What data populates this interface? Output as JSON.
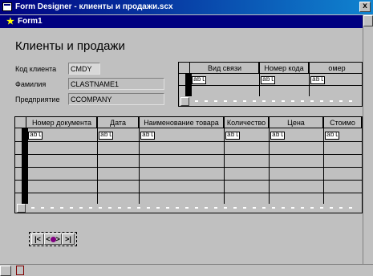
{
  "window": {
    "title": "Form Designer - клиенты и продажи.scx",
    "close_glyph": "x"
  },
  "form_tab": {
    "label": "Form1"
  },
  "form": {
    "heading": "Клиенты и продажи",
    "fields": [
      {
        "label": "Код клиента",
        "value": "CMDY"
      },
      {
        "label": "Фамилия",
        "value": "CLASTNAME1"
      },
      {
        "label": "Предприятие",
        "value": "CCOMPANY"
      }
    ]
  },
  "contacts_grid": {
    "columns": [
      "Вид связи",
      "Номер кода",
      "омер"
    ],
    "cells": [
      "abl",
      "abl",
      "abl"
    ]
  },
  "sales_grid": {
    "columns": [
      "Номер документа",
      "Дата",
      "Наименование товара",
      "Количество",
      "Цена",
      "Стоимо"
    ],
    "cells": [
      "abl",
      "abl",
      "abl",
      "abl",
      "abl",
      "abl"
    ]
  },
  "navigator": {
    "first": "|<",
    "prev": "<",
    "next": ">",
    "last": ">|"
  }
}
